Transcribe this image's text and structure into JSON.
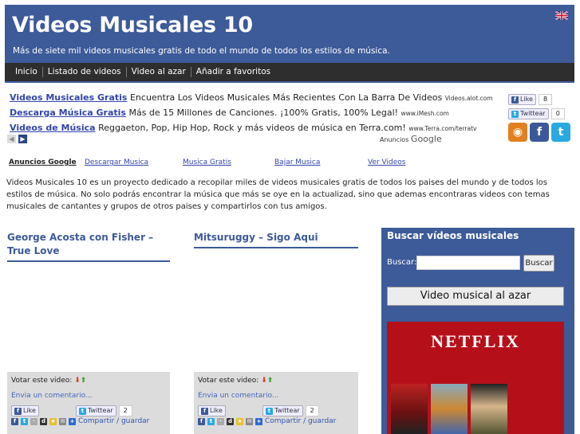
{
  "header": {
    "title": "Videos Musicales 10",
    "subtitle": "Más de siete mil videos musicales gratis de todo el mundo de todos los estilos de música."
  },
  "nav": [
    "Inicio",
    "Listado de videos",
    "Video al azar",
    "Añadir a favoritos"
  ],
  "ads": [
    {
      "title": "Videos Musicales Gratis",
      "text": "Encuentra Los Videos Musicales Más Recientes Con La Barra De Videos",
      "url": "Videos.alot.com"
    },
    {
      "title": "Descarga Música Gratis",
      "text": "Más de 15 Millones de Canciones. ¡100% Gratis, 100% Legal!",
      "url": "www.iMesh.com"
    },
    {
      "title": "Videos de Música",
      "text": "Reggaeton, Pop, Hip Hop, Rock y más videos de música en Terra.com!",
      "url": "www.Terra.com/terratv"
    }
  ],
  "ads_by": {
    "prefix": "Anuncios",
    "brand": "Google"
  },
  "social": {
    "like_label": "Like",
    "like_count": "8",
    "tweet_label": "Twittear",
    "tweet_count": "0"
  },
  "ad_links": {
    "label": "Anuncios Google",
    "items": [
      "Descargar Musica",
      "Musica Gratis",
      "Bajar Musica",
      "Ver Videos"
    ]
  },
  "intro": "Videos Musicales 10 es un proyecto dedicado a recopilar miles de videos musicales gratis de todos los paises del mundo y de todos los estilos de música. No solo podrás encontrar la música que más se oye en la actualizad, sino que ademas encontraras videos con temas musicales de cantantes y grupos de otros paises y compartirlos con tus amigos.",
  "posts": [
    {
      "title": "George Acosta con Fisher – True Love",
      "vote_label": "Votar este video:",
      "comment": "Envia un comentario...",
      "like": "Like",
      "tweet": "Twittear",
      "tweet_count": "2",
      "share": "Compartir / guardar"
    },
    {
      "title": "Mitsuruggy – Sigo Aqui",
      "vote_label": "Votar este video:",
      "comment": "Envia un comentario...",
      "like": "Like",
      "tweet": "Twittear",
      "tweet_count": "2",
      "share": "Compartir / guardar"
    }
  ],
  "sidebar": {
    "title": "Buscar vídeos musicales",
    "search_label": "Buscar:",
    "search_button": "Buscar",
    "random_button": "Video musical al azar",
    "netflix_logo": "NETFLIX"
  },
  "colors": {
    "brand": "#3d5a99",
    "nav": "#2e2e2e",
    "netflix": "#b5101a"
  }
}
